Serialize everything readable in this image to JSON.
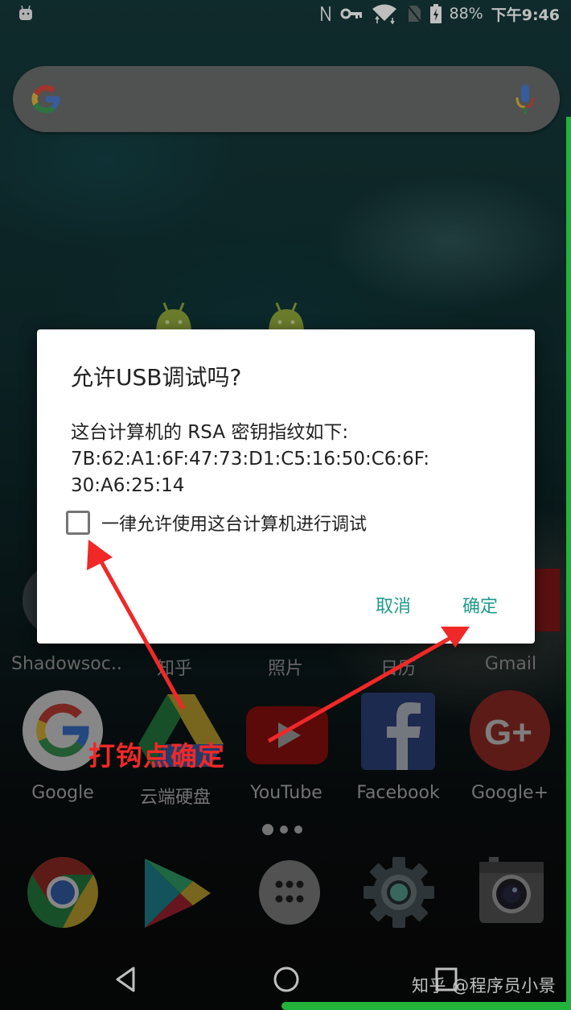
{
  "status_bar": {
    "battery": "88%",
    "time": "下午9:46",
    "icons": [
      "android-debug-icon",
      "nfc-icon",
      "vpn-key-icon",
      "wifi-icon",
      "no-sim-icon",
      "battery-charging-icon"
    ]
  },
  "search_bar": {
    "left_icon": "google-g-icon",
    "right_icon": "microphone-icon"
  },
  "hidden_row": {
    "labels": [
      "Shadowsoc..",
      "知乎",
      "照片",
      "日历",
      "Gmail"
    ]
  },
  "apps_row": {
    "labels": [
      "Google",
      "云端硬盘",
      "YouTube",
      "Facebook",
      "Google+"
    ]
  },
  "page_indicator": {
    "pages": 3,
    "current": 1
  },
  "dock": {
    "apps": [
      "Chrome",
      "Play Store",
      "App Drawer",
      "Settings",
      "Camera"
    ]
  },
  "dialog": {
    "title": "允许USB调试吗?",
    "body_line1": "这台计算机的 RSA 密钥指纹如下:",
    "body_line2": "7B:62:A1:6F:47:73:D1:C5:16:50:C6:6F:",
    "body_line3": "30:A6:25:14",
    "checkbox_label": "一律允许使用这台计算机进行调试",
    "checkbox_checked": false,
    "cancel_label": "取消",
    "ok_label": "确定",
    "accent_color": "#1f9b8b"
  },
  "annotation": {
    "text": "打钩点确定",
    "color": "#f02828"
  },
  "watermark": "知乎 @程序员小景"
}
